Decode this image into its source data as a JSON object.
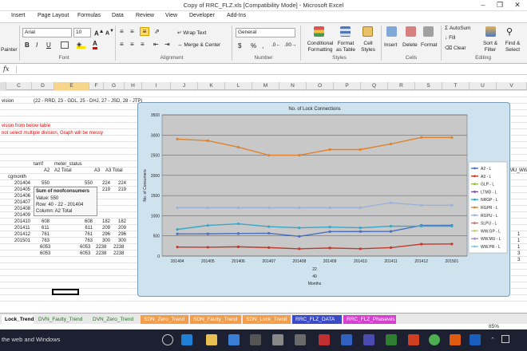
{
  "window": {
    "title": "Copy of RRC_FLZ.xls [Compatibility Mode] - Microsoft Excel"
  },
  "menu": {
    "tabs": [
      "Insert",
      "Page Layout",
      "Formulas",
      "Data",
      "Review",
      "View",
      "Developer",
      "Add-Ins"
    ]
  },
  "ribbon": {
    "painter_label": "Painter",
    "font_name": "Arial",
    "font_size": "10",
    "wrap_text": "Wrap Text",
    "merge_center": "Merge & Center",
    "number_format": "General",
    "conditional_formatting": "Conditional Formatting",
    "format_as_table": "Format as Table",
    "cell_styles": "Cell Styles",
    "insert": "Insert",
    "delete": "Delete",
    "format": "Format",
    "autosum": "AutoSum",
    "fill": "Fill",
    "clear": "Clear",
    "sort_filter": "Sort & Filter",
    "find_select": "Find & Select",
    "groups": {
      "font": "Font",
      "alignment": "Alignment",
      "number": "Number",
      "styles": "Styles",
      "cells": "Cells",
      "editing": "Editing"
    }
  },
  "formula_bar": {
    "fx": "fx"
  },
  "columns": [
    "C",
    "D",
    "E",
    "F",
    "G",
    "H",
    "I",
    "J",
    "K",
    "L",
    "M",
    "N",
    "O",
    "P",
    "Q",
    "R",
    "S",
    "T",
    "U",
    "V"
  ],
  "sheet": {
    "vision_label": "vision",
    "division_note": "(22 - RRD, 23 - GDL, 25 - DHJ, 27 - JSD, 28 - JTP)",
    "red_line1": "vision from below table",
    "red_line2": "not select multiple division, Graph will be messy",
    "tarrif": "tarrif",
    "meter_status": "meter_status",
    "hdr_a2": "A2",
    "hdr_a2_total": "A2 Total",
    "hdr_a3": "A3",
    "hdr_a3_total": "A3 Total",
    "hdr_cgmonth": "cgmonth",
    "months": [
      "201404",
      "201405",
      "201406",
      "201407",
      "201408",
      "201409",
      "201410",
      "201411",
      "201412",
      "201501"
    ],
    "a2": [
      "550",
      "551",
      "559",
      "565",
      "489",
      "606",
      "608",
      "611",
      "761",
      "763"
    ],
    "row_extra_a3": [
      "224",
      "219",
      "",
      "",
      "",
      "",
      "182",
      "209",
      "296",
      "300"
    ],
    "row_extra_a3b": [
      "224",
      "219",
      "",
      "",
      "",
      "",
      "182",
      "209",
      "296",
      "300"
    ],
    "totals": [
      "6053",
      "6053",
      "2238",
      "2238"
    ],
    "totals2": [
      "6053",
      "6053",
      "2238",
      "2238"
    ],
    "right_col": [
      "MU_",
      "WW"
    ],
    "right_vals": [
      "1",
      "1",
      "1",
      "3",
      "3"
    ]
  },
  "tooltip": {
    "line1": "Sum of noofconsumers",
    "line2": "Value: 550",
    "line3": "Row: 40 - 22 - 201404",
    "line4": "Column: A2 Total"
  },
  "chart_data": {
    "type": "line",
    "title": "No. of Lock Connections",
    "ylabel": "No. of Consumers",
    "xlabel": "22\n40\nMonths",
    "ylim": [
      0,
      3500
    ],
    "yticks": [
      0,
      500,
      1000,
      1500,
      2000,
      2500,
      3000,
      3500
    ],
    "categories": [
      "201404",
      "201405",
      "201406",
      "201407",
      "201408",
      "201409",
      "201410",
      "201411",
      "201412",
      "201501"
    ],
    "series": [
      {
        "name": "A2 - L",
        "color": "#4a6fc0",
        "values": [
          550,
          551,
          559,
          565,
          489,
          606,
          608,
          611,
          761,
          763
        ]
      },
      {
        "name": "A3 - L",
        "color": "#c0392b",
        "values": [
          224,
          219,
          230,
          210,
          180,
          200,
          182,
          209,
          296,
          300
        ]
      },
      {
        "name": "GLP - L",
        "color": "#8fbf3f",
        "values": [
          null,
          null,
          null,
          null,
          null,
          null,
          null,
          null,
          null,
          null
        ]
      },
      {
        "name": "LTMD - L",
        "color": "#7a4fa0",
        "values": [
          null,
          null,
          null,
          null,
          null,
          null,
          null,
          null,
          null,
          null
        ]
      },
      {
        "name": "NRGP - L",
        "color": "#35a7c8",
        "values": [
          660,
          760,
          800,
          730,
          700,
          720,
          700,
          740,
          740,
          740
        ]
      },
      {
        "name": "RGPR - L",
        "color": "#e0822b",
        "values": [
          2900,
          2860,
          2700,
          2500,
          2500,
          2640,
          2640,
          2780,
          2940,
          2940
        ]
      },
      {
        "name": "RGPU - L",
        "color": "#9bb2d8",
        "values": [
          1200,
          1200,
          1200,
          1200,
          1200,
          1200,
          1200,
          1320,
          1260,
          1260
        ]
      },
      {
        "name": "SLPU - L",
        "color": "#d96a6a",
        "values": [
          null,
          null,
          null,
          null,
          null,
          null,
          null,
          null,
          null,
          null
        ]
      },
      {
        "name": "WW.GP - L",
        "color": "#b7d36b",
        "values": [
          null,
          null,
          null,
          null,
          null,
          null,
          null,
          null,
          null,
          null
        ]
      },
      {
        "name": "WW.MU - L",
        "color": "#a58cc8",
        "values": [
          null,
          null,
          null,
          null,
          null,
          null,
          null,
          null,
          null,
          null
        ]
      },
      {
        "name": "WW.PR - L",
        "color": "#7fc6de",
        "values": [
          null,
          null,
          null,
          null,
          null,
          null,
          null,
          null,
          null,
          null
        ]
      }
    ]
  },
  "sheet_tabs": [
    {
      "label": "Lock_Trend",
      "color": "#ffffff",
      "text": "#000"
    },
    {
      "label": "DVN_Faulty_Trend",
      "color": "#e8e8e8",
      "text": "#1a7a1a"
    },
    {
      "label": "DVN_Zero_Trend",
      "color": "#e8e8e8",
      "text": "#1a7a1a"
    },
    {
      "label": "SDN_Zero_Trend",
      "color": "#f39c4a",
      "text": "#fff"
    },
    {
      "label": "SDN_Faulty_Trend",
      "color": "#f39c4a",
      "text": "#fff"
    },
    {
      "label": "SDN_Lock_Trend",
      "color": "#f39c4a",
      "text": "#fff"
    },
    {
      "label": "RRC_FLZ_DATA",
      "color": "#3b4bc8",
      "text": "#fff"
    },
    {
      "label": "RRC_FLZ_Phasewis",
      "color": "#d63fd0",
      "text": "#fff"
    }
  ],
  "status": {
    "zoom": "85%"
  },
  "taskbar": {
    "search": "the web and Windows"
  }
}
